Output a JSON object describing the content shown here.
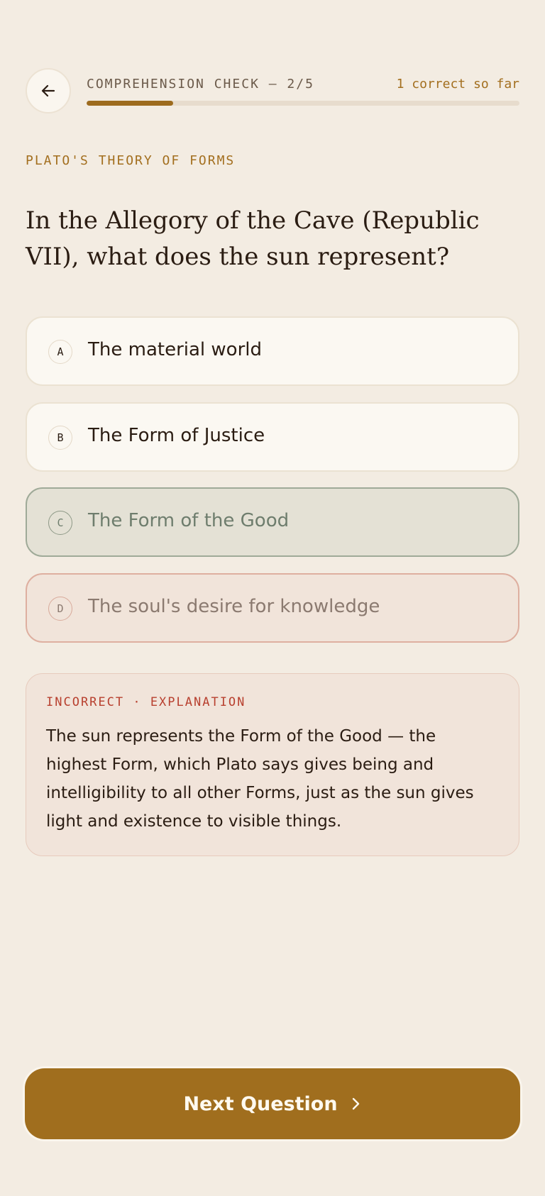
{
  "header": {
    "progress_label": "COMPREHENSION CHECK — 2/5",
    "score_text": "1 correct so far",
    "progress_fraction": 0.2
  },
  "category": "PLATO'S THEORY OF FORMS",
  "question": "In the Allegory of the Cave (Republic VII), what does the sun represent?",
  "options": [
    {
      "letter": "A",
      "text": "The material world",
      "state": "neutral"
    },
    {
      "letter": "B",
      "text": "The Form of Justice",
      "state": "neutral"
    },
    {
      "letter": "C",
      "text": "The Form of the Good",
      "state": "correct"
    },
    {
      "letter": "D",
      "text": "The soul's desire for knowledge",
      "state": "selected-wrong"
    }
  ],
  "explanation": {
    "label": "INCORRECT · EXPLANATION",
    "text": "The sun represents the Form of the Good — the highest Form, which Plato says gives being and intelligibility to all other Forms, just as the sun gives light and existence to visible things."
  },
  "next_button": {
    "label": "Next Question"
  },
  "colors": {
    "accent": "#a06e1e",
    "background": "#f3ece2",
    "correct": "#6e7d6d",
    "incorrect": "#b8402f"
  },
  "icons": {
    "back": "arrow-left-icon",
    "next": "chevron-right-icon"
  }
}
